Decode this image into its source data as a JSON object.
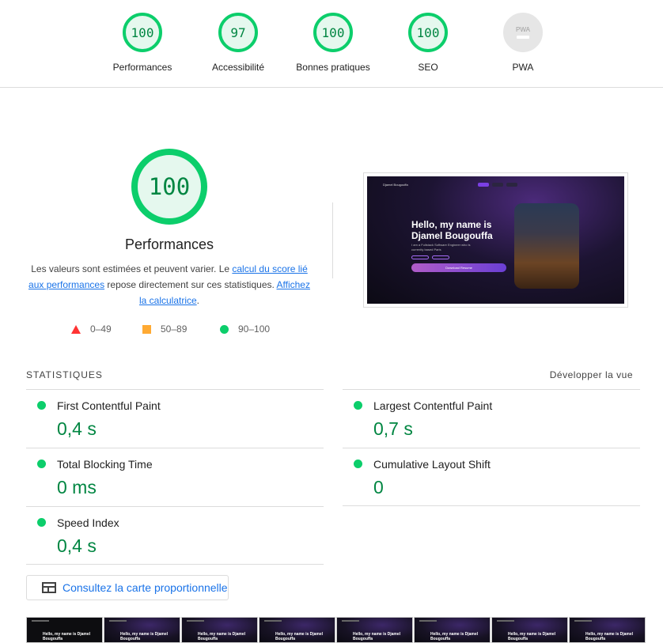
{
  "scores": [
    {
      "label": "Performances",
      "value": "100"
    },
    {
      "label": "Accessibilité",
      "value": "97"
    },
    {
      "label": "Bonnes pratiques",
      "value": "100"
    },
    {
      "label": "SEO",
      "value": "100"
    },
    {
      "label": "PWA",
      "value": "PWA"
    }
  ],
  "performance": {
    "score": "100",
    "title": "Performances",
    "desc_prefix": "Les valeurs sont estimées et peuvent varier. Le ",
    "desc_link1": "calcul du score lié aux performances",
    "desc_mid": " repose directement sur ces statistiques. ",
    "desc_link2": "Affichez la calculatrice",
    "desc_suffix": "."
  },
  "legend": [
    {
      "icon": "fail-triangle-icon",
      "range": "0–49",
      "color": "#ff3333"
    },
    {
      "icon": "average-square-icon",
      "range": "50–89",
      "color": "#ffaa33"
    },
    {
      "icon": "pass-circle-icon",
      "range": "90–100",
      "color": "#0cce6b"
    }
  ],
  "preview": {
    "brand": "Djamel Bougouffa",
    "heading": "Hello, my name is Djamel Bougouffa",
    "subtitle": "I am a Fullstack Software Engineer who is currently based Paris",
    "download_label": "Download Resume"
  },
  "statistics": {
    "header": "STATISTIQUES",
    "expand_label": "Développer la vue",
    "metrics": [
      {
        "name": "First Contentful Paint",
        "value": "0,4 s"
      },
      {
        "name": "Largest Contentful Paint",
        "value": "0,7 s"
      },
      {
        "name": "Total Blocking Time",
        "value": "0 ms"
      },
      {
        "name": "Cumulative Layout Shift",
        "value": "0"
      },
      {
        "name": "Speed Index",
        "value": "0,4 s"
      }
    ]
  },
  "treemap_button": "Consultez la carte proportionnelle",
  "filmstrip": {
    "frame_text": "Hello, my name is Djamel Bougouffa"
  },
  "colors": {
    "pass": "#0cce6b",
    "pass_text": "#018642",
    "link": "#1a73e8"
  }
}
